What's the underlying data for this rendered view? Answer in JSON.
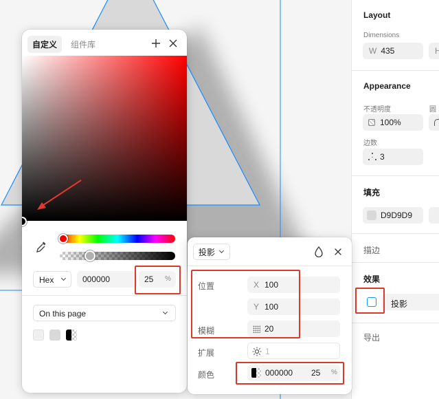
{
  "panel": {
    "layout_title": "Layout",
    "dimensions_label": "Dimensions",
    "width_prefix": "W",
    "width_value": "435",
    "height_prefix": "H",
    "appearance_title": "Appearance",
    "opacity_label": "不透明度",
    "radius_label": "圆角",
    "opacity_value": "100%",
    "sides_label": "边数",
    "sides_value": "3",
    "fill_title": "填充",
    "fill_hex": "D9D9D9",
    "fill_color": "#d9d9d9",
    "stroke_title": "描边",
    "effects_title": "效果",
    "effect_name": "投影",
    "export_title": "导出"
  },
  "picker": {
    "tabs": [
      {
        "label": "自定义",
        "active": true
      },
      {
        "label": "组件库",
        "active": false
      }
    ],
    "hue_color": "#ff0000",
    "alpha_percent": 25,
    "format": "Hex",
    "hex_value": "000000",
    "alpha_value": "25",
    "alpha_unit": "%",
    "library_select": "On this page",
    "swatches": [
      "#f0f0f0",
      "#d9d9d9",
      "#000000"
    ]
  },
  "shadow": {
    "type_label": "投影",
    "position_label": "位置",
    "x_prefix": "X",
    "x_value": "100",
    "y_prefix": "Y",
    "y_value": "100",
    "blur_label": "模糊",
    "blur_value": "20",
    "spread_label": "扩展",
    "spread_value": "1",
    "color_label": "颜色",
    "color_hex": "000000",
    "color_alpha": "25",
    "color_unit": "%"
  },
  "colors": {
    "accent": "#0d99ff",
    "annotation_red": "#d8392b",
    "triangle_fill": "#d9d9d9"
  }
}
